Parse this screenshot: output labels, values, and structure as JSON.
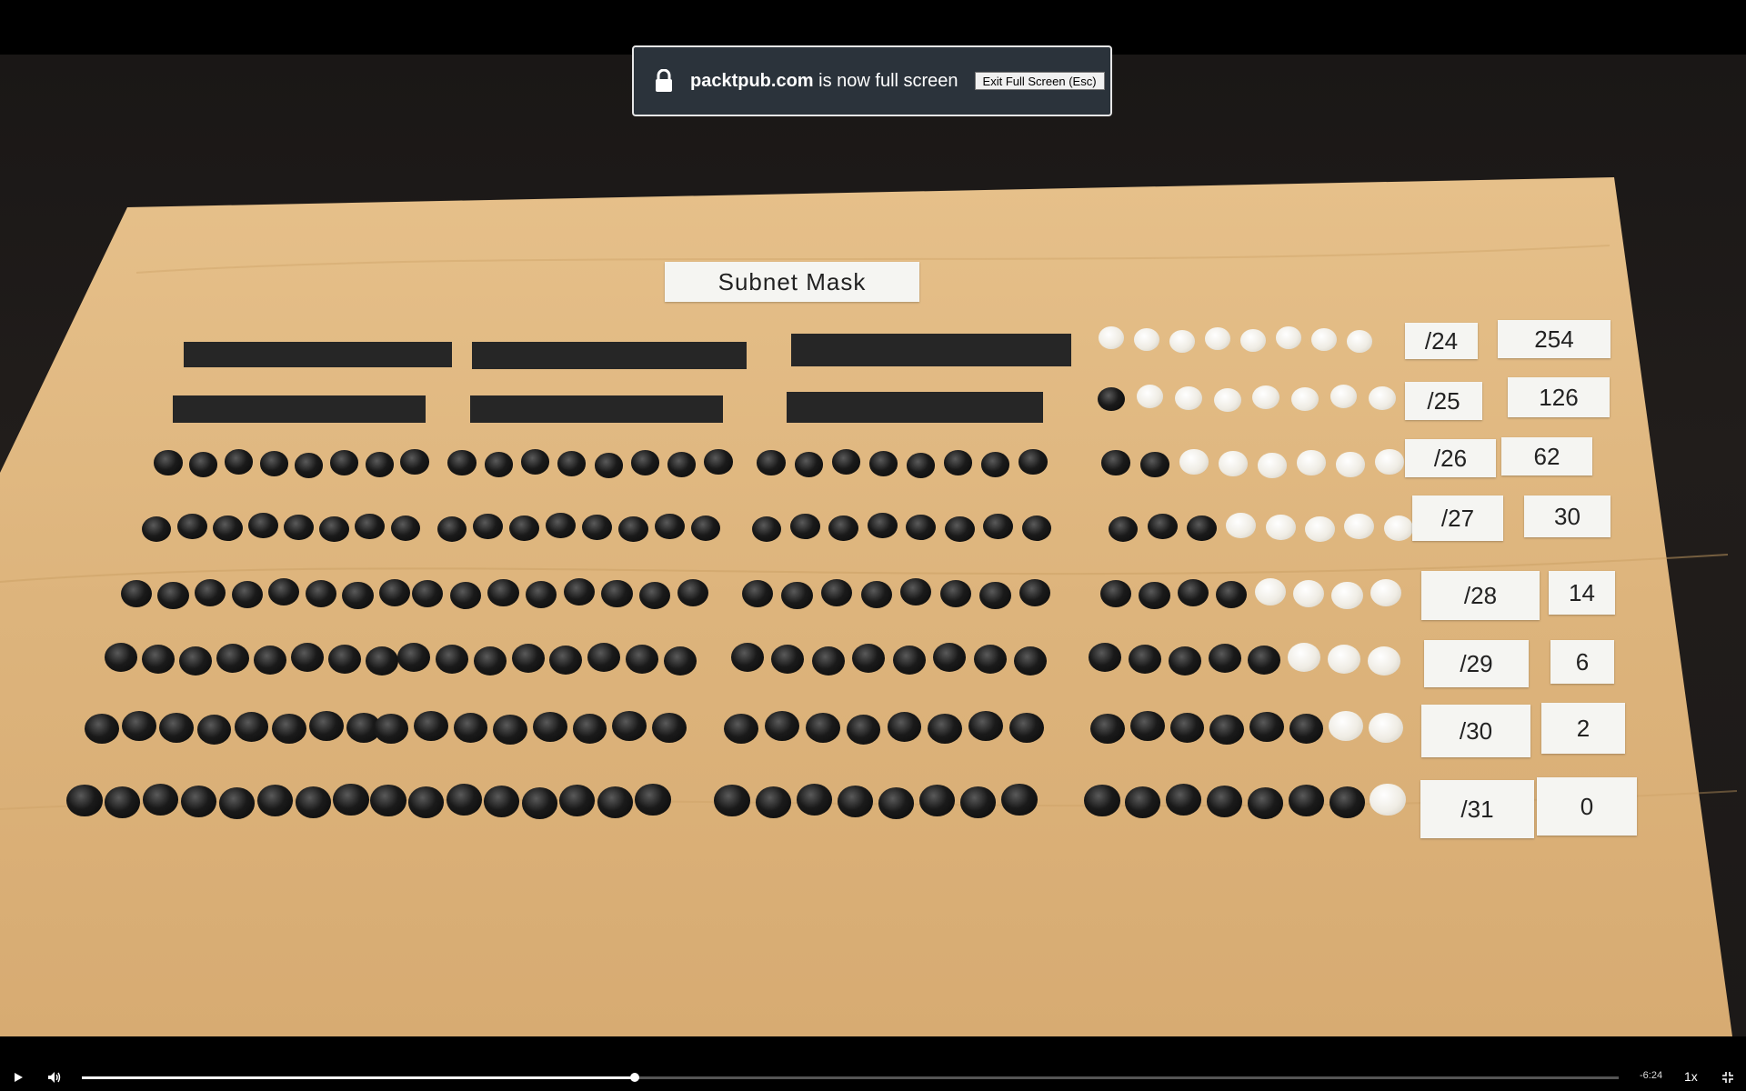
{
  "board": {
    "title": "Subnet Mask",
    "rows": [
      {
        "prefix": "/24",
        "hosts": "254"
      },
      {
        "prefix": "/25",
        "hosts": "126"
      },
      {
        "prefix": "/26",
        "hosts": "62"
      },
      {
        "prefix": "/27",
        "hosts": "30"
      },
      {
        "prefix": "/28",
        "hosts": "14"
      },
      {
        "prefix": "/29",
        "hosts": "6"
      },
      {
        "prefix": "/30",
        "hosts": "2"
      },
      {
        "prefix": "/31",
        "hosts": "0"
      }
    ],
    "colors": {
      "wood": "#d9b27a",
      "bead_black": "#111111",
      "bead_white": "#f2efe7"
    }
  },
  "fullscreen_notice": {
    "domain": "packtpub.com",
    "message": "is now full screen",
    "exit_button": "Exit Full Screen (Esc)"
  },
  "player": {
    "time_remaining": "-6:24",
    "speed": "1x",
    "progress_fraction": 0.36,
    "icons": {
      "play": "play-icon",
      "volume": "volume-icon",
      "fullscreen": "exit-fullscreen-icon"
    }
  }
}
